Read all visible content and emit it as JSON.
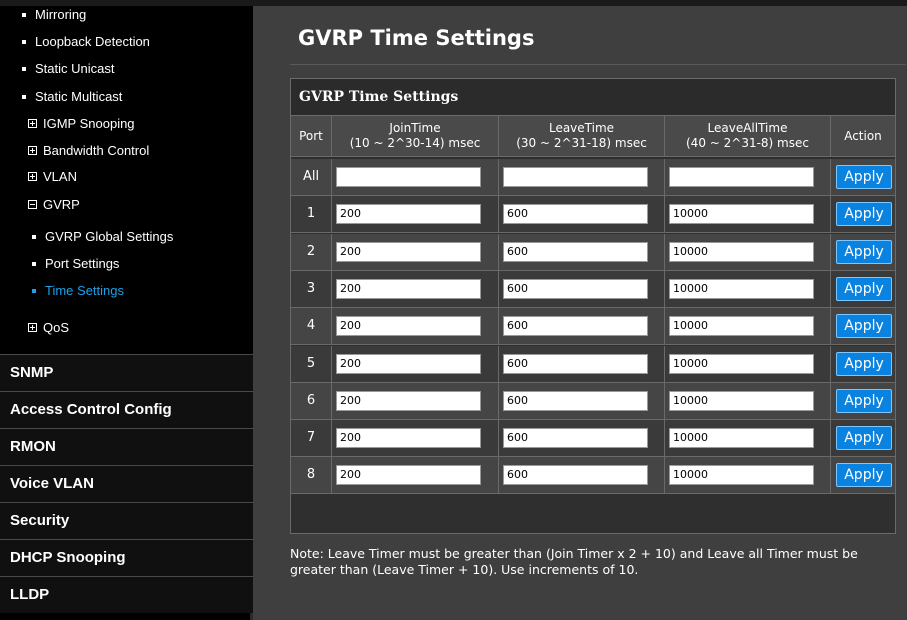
{
  "sidebar": {
    "sub_items": [
      {
        "label": "Mirroring",
        "kind": "bullet"
      },
      {
        "label": "Loopback Detection",
        "kind": "bullet"
      },
      {
        "label": "Static Unicast",
        "kind": "bullet"
      },
      {
        "label": "Static Multicast",
        "kind": "bullet"
      },
      {
        "label": "IGMP Snooping",
        "kind": "expand"
      },
      {
        "label": "Bandwidth Control",
        "kind": "expand"
      },
      {
        "label": "VLAN",
        "kind": "expand"
      },
      {
        "label": "GVRP",
        "kind": "collapse"
      },
      {
        "label": "GVRP Global Settings",
        "kind": "bullet-l2"
      },
      {
        "label": "Port Settings",
        "kind": "bullet-l2"
      },
      {
        "label": "Time Settings",
        "kind": "bullet-l2",
        "active": true
      },
      {
        "label": "QoS",
        "kind": "expand"
      }
    ],
    "categories": [
      "SNMP",
      "Access Control Config",
      "RMON",
      "Voice VLAN",
      "Security",
      "DHCP Snooping",
      "LLDP"
    ],
    "active_color": "#1ea0e6"
  },
  "page": {
    "title": "GVRP Time Settings",
    "panel_title": "GVRP Time Settings"
  },
  "table": {
    "headers": {
      "port": "Port",
      "join": "JoinTime",
      "join_range": "(10 ~ 2^30-14) msec",
      "leave": "LeaveTime",
      "leave_range": "(30 ~ 2^31-18) msec",
      "leaveall": "LeaveAllTime",
      "leaveall_range": "(40 ~ 2^31-8) msec",
      "action": "Action"
    },
    "rows": [
      {
        "port": "All",
        "join": "",
        "leave": "",
        "leaveall": "",
        "action": "Apply"
      },
      {
        "port": "1",
        "join": "200",
        "leave": "600",
        "leaveall": "10000",
        "action": "Apply"
      },
      {
        "port": "2",
        "join": "200",
        "leave": "600",
        "leaveall": "10000",
        "action": "Apply"
      },
      {
        "port": "3",
        "join": "200",
        "leave": "600",
        "leaveall": "10000",
        "action": "Apply"
      },
      {
        "port": "4",
        "join": "200",
        "leave": "600",
        "leaveall": "10000",
        "action": "Apply"
      },
      {
        "port": "5",
        "join": "200",
        "leave": "600",
        "leaveall": "10000",
        "action": "Apply"
      },
      {
        "port": "6",
        "join": "200",
        "leave": "600",
        "leaveall": "10000",
        "action": "Apply"
      },
      {
        "port": "7",
        "join": "200",
        "leave": "600",
        "leaveall": "10000",
        "action": "Apply"
      },
      {
        "port": "8",
        "join": "200",
        "leave": "600",
        "leaveall": "10000",
        "action": "Apply"
      }
    ]
  },
  "note": "Note: Leave Timer must be greater than (Join Timer x 2 + 10) and Leave all Timer must be greater than (Leave Timer + 10). Use increments of 10.",
  "colors": {
    "apply_button": "#0a83e0",
    "sidebar_bg": "#000000",
    "content_bg": "#3f3f3f"
  }
}
